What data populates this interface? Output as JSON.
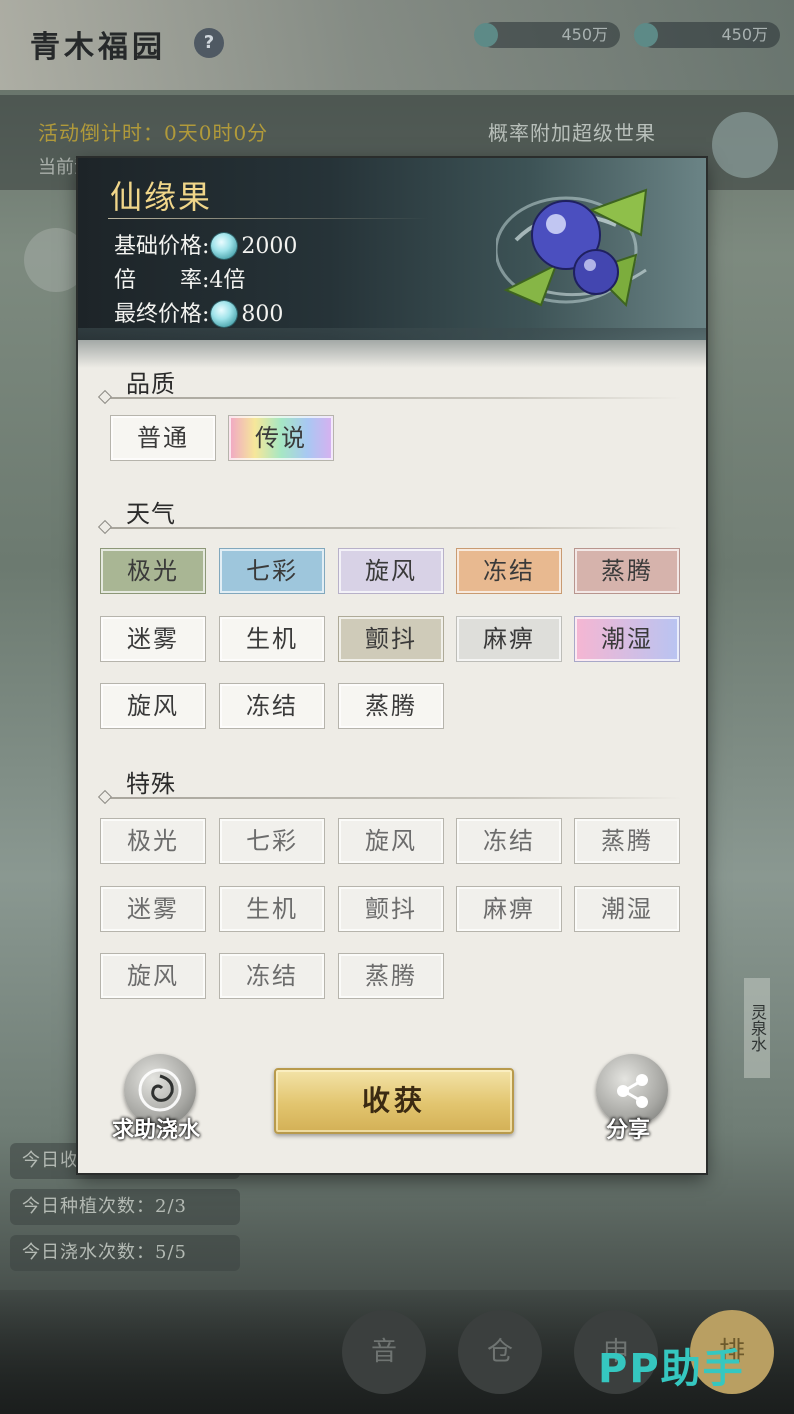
{
  "background": {
    "title": "青木福园",
    "help_glyph": "?",
    "currency": [
      "450万",
      "450万"
    ],
    "countdown": "活动倒计时：0天0时0分",
    "band_sub": "当前活动进行中",
    "right_note": "概率附加超级世果",
    "stats": [
      "今日收获次数",
      "今日种植次数：2/3",
      "今日浇水次数：5/5"
    ],
    "side_tag": "灵泉水",
    "bottom_buttons": [
      "音",
      "仓",
      "申",
      "排"
    ],
    "watermark": "PP助手"
  },
  "modal": {
    "item_name": "仙缘果",
    "base_price_label": "基础价格:",
    "base_price": "2000",
    "rate_label": "倍　　率:",
    "rate": "4倍",
    "final_price_label": "最终价格:",
    "final_price": "800"
  },
  "quality": {
    "title": "品质",
    "tags": [
      "普通",
      "传说"
    ]
  },
  "weather": {
    "title": "天气",
    "tags": [
      "极光",
      "七彩",
      "旋风",
      "冻结",
      "蒸腾",
      "迷雾",
      "生机",
      "颤抖",
      "麻痹",
      "潮湿",
      "旋风",
      "冻结",
      "蒸腾"
    ]
  },
  "special": {
    "title": "特殊",
    "tags": [
      "极光",
      "七彩",
      "旋风",
      "冻结",
      "蒸腾",
      "迷雾",
      "生机",
      "颤抖",
      "麻痹",
      "潮湿",
      "旋风",
      "冻结",
      "蒸腾"
    ]
  },
  "actions": {
    "help_water": "求助浇水",
    "harvest": "收获",
    "share": "分享"
  },
  "colors": {
    "tag_legend": "linear-gradient(90deg,#f0a6c6,#f6e79a,#a6e7c4,#a8c8f2,#d8b0f0)",
    "tag_aurora": "#a9b694",
    "tag_rainbow": "#9ec6dc",
    "tag_whirlwind": "#d8d2e6",
    "tag_freeze": "#e8b990",
    "tag_steam": "#d6b3ac",
    "tag_tremble": "#cfcbb9",
    "tag_paralysis": "#dededa",
    "tag_humid": "linear-gradient(90deg,#f6b6d2,#b8c4f2)"
  }
}
